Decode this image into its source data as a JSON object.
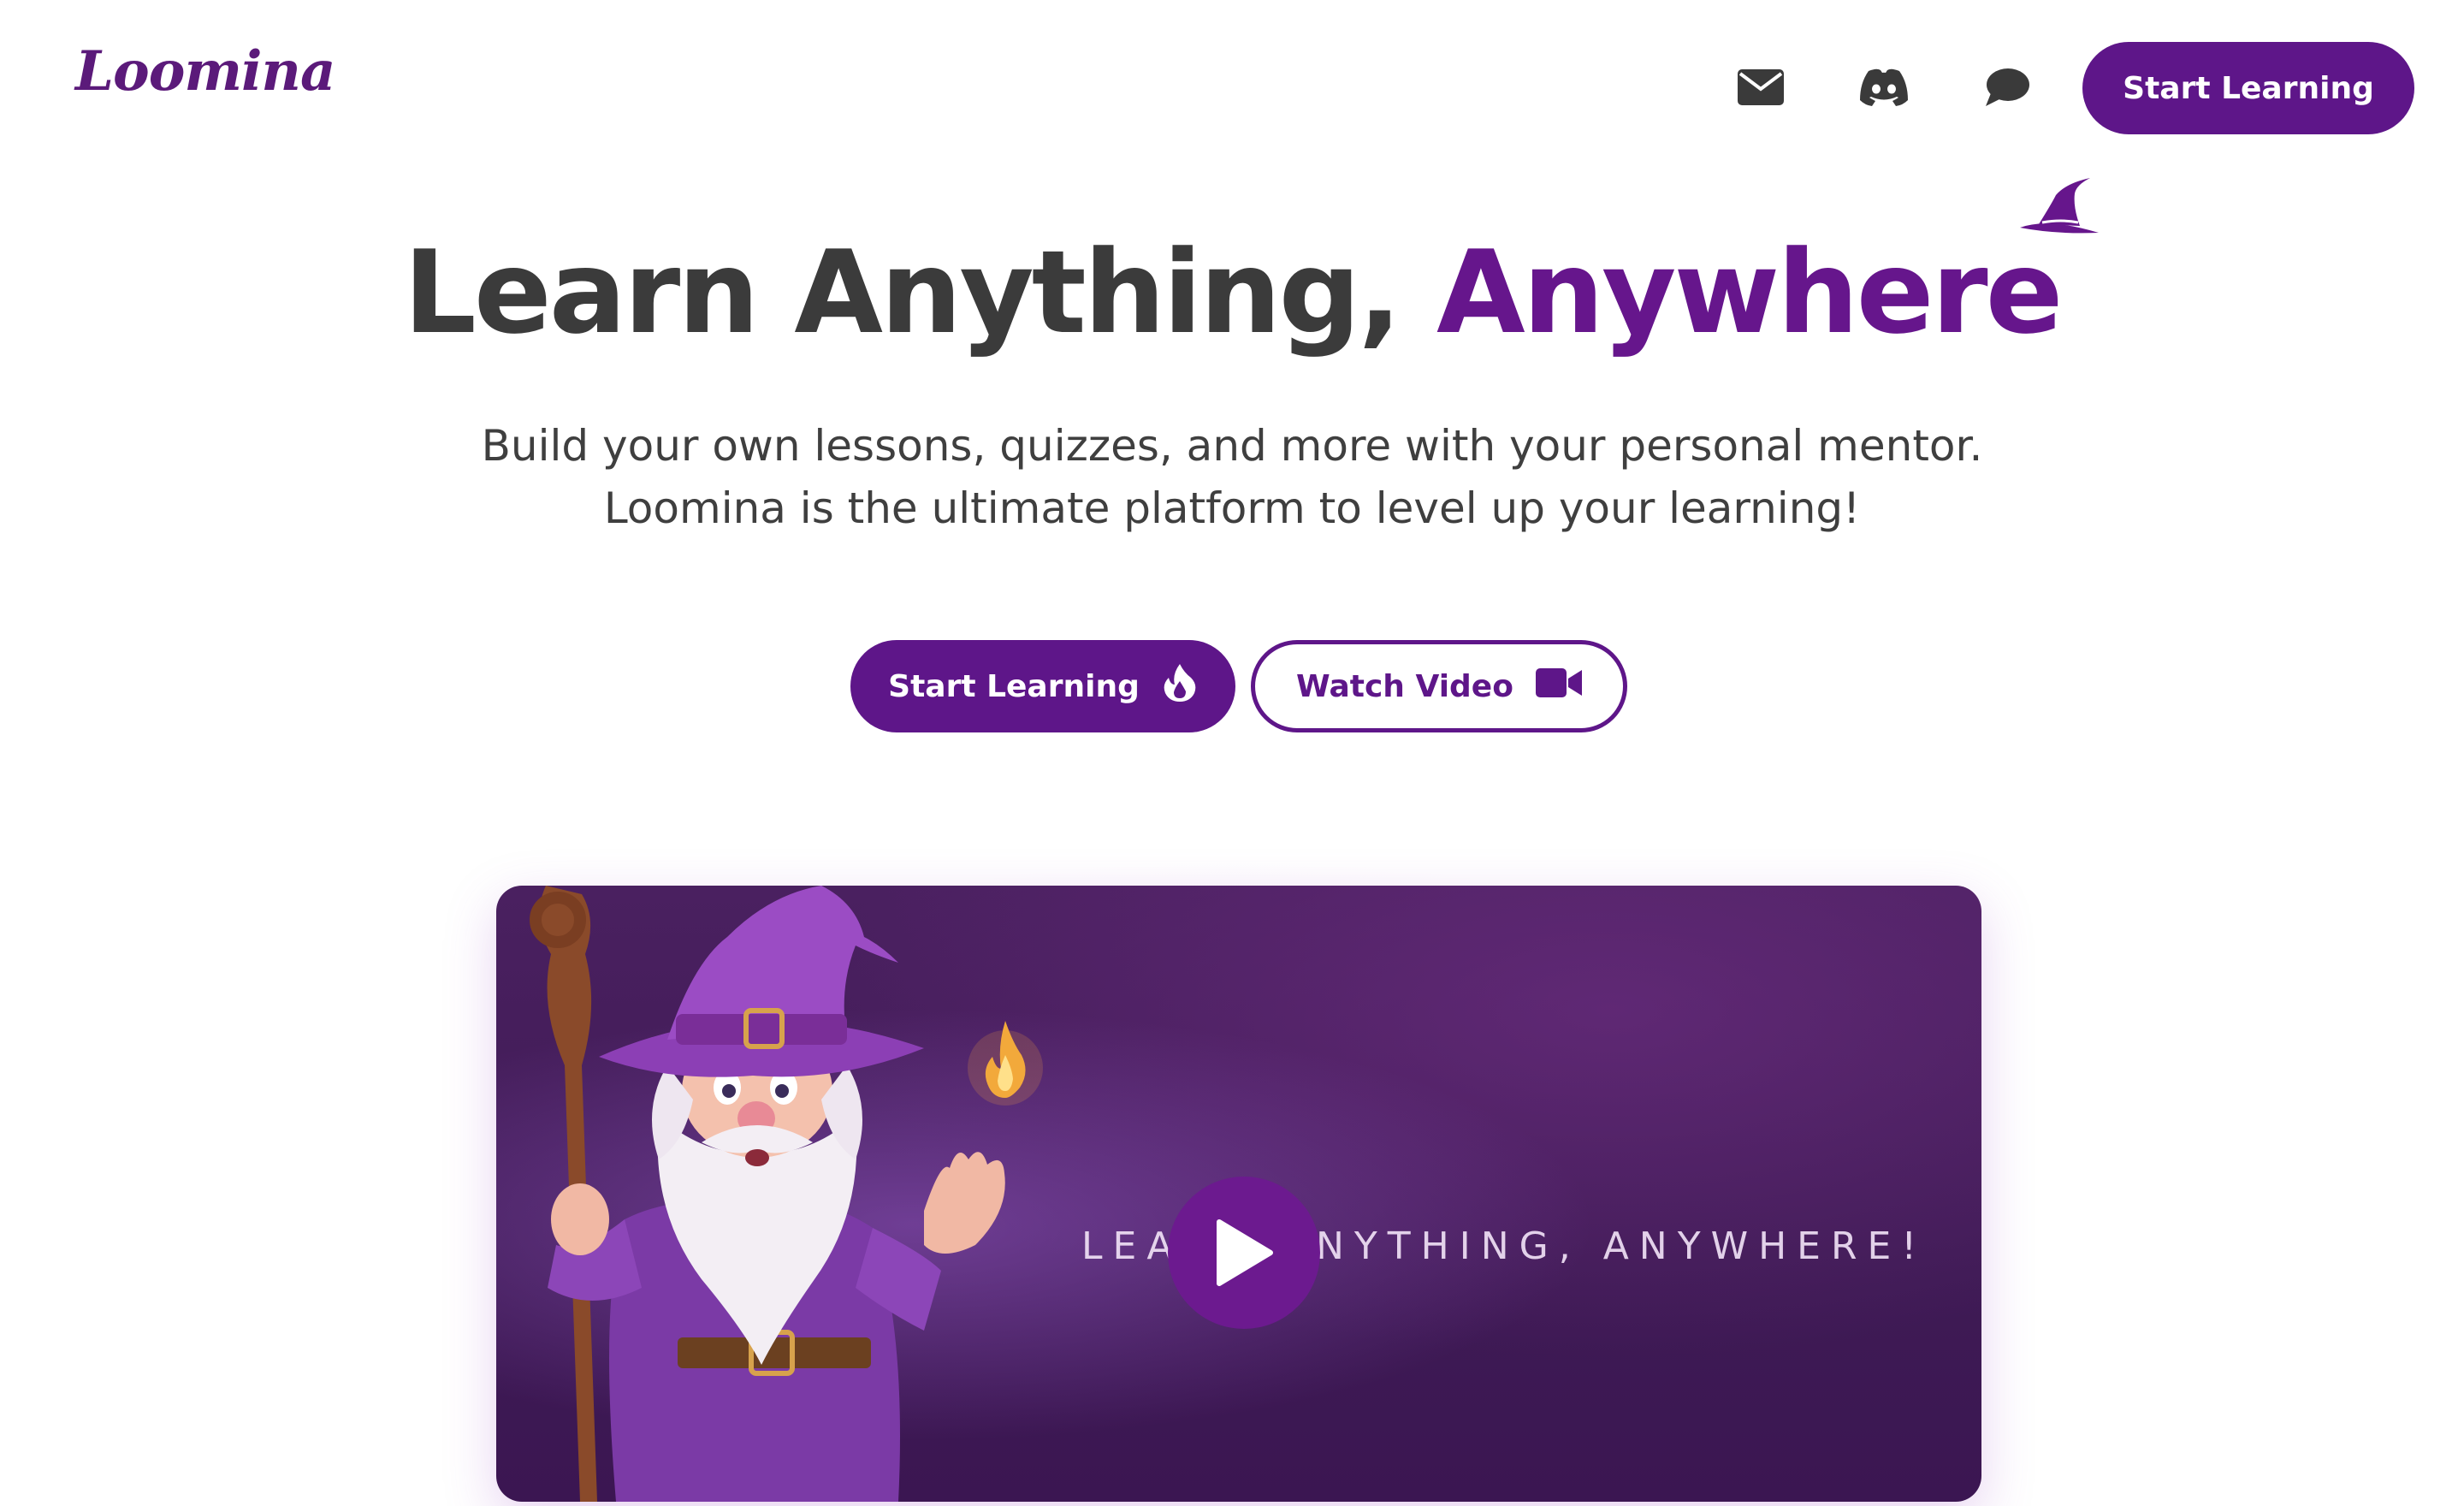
{
  "brand": {
    "logo_text": "Loomina",
    "accent_color": "#5e1689"
  },
  "header": {
    "icons": [
      "mail-icon",
      "discord-icon",
      "chat-icon"
    ],
    "cta_label": "Start Learning"
  },
  "hero": {
    "title_main": "Learn Anything, ",
    "title_accent": "Anywhere",
    "subtitle_line1": "Build your own lessons, quizzes, and more with your personal mentor.",
    "subtitle_line2": "Loomina is the ultimate platform to level up your learning!",
    "primary_button_label": "Start Learning",
    "primary_button_icon": "fire-icon",
    "secondary_button_label": "Watch Video",
    "secondary_button_icon": "video-camera-icon"
  },
  "video": {
    "overlay_text": "LEARN ANYTHING, ANYWHERE!",
    "play_icon": "play-icon"
  }
}
